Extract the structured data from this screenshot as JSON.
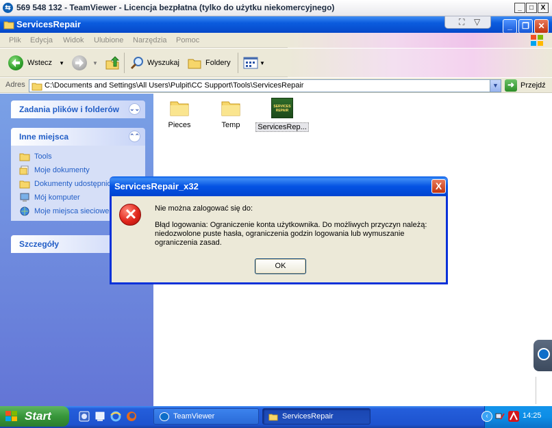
{
  "teamviewer": {
    "title": "569 548 132 - TeamViewer - Licencja bezpłatna (tylko do użytku niekomercyjnego)",
    "minimize": "_",
    "maximize": "□",
    "close": "X"
  },
  "explorer": {
    "title": "ServicesRepair",
    "menu": [
      "Plik",
      "Edycja",
      "Widok",
      "Ulubione",
      "Narzędzia",
      "Pomoc"
    ],
    "toolbar": {
      "back_label": "Wstecz",
      "search_label": "Wyszukaj",
      "folders_label": "Foldery"
    },
    "address": {
      "label": "Adres",
      "path": "C:\\Documents and Settings\\All Users\\Pulpit\\CC Support\\Tools\\ServicesRepair",
      "go_label": "Przejdź"
    },
    "left_panel": {
      "tasks_title": "Zadania plików i folderów",
      "places_title": "Inne miejsca",
      "places": [
        "Tools",
        "Moje dokumenty",
        "Dokumenty udostępnione",
        "Mój komputer",
        "Moje miejsca sieciowe"
      ],
      "details_title": "Szczegóły"
    },
    "files": [
      {
        "name": "Pieces",
        "type": "folder"
      },
      {
        "name": "Temp",
        "type": "folder"
      },
      {
        "name": "ServicesRep...",
        "type": "app",
        "icon_text": "SERVICES REPAIR"
      }
    ]
  },
  "dialog": {
    "title": "ServicesRepair_x32",
    "line1": "Nie można zalogować się do:",
    "line2": "Błąd logowania: Ograniczenie konta użytkownika. Do możliwych przyczyn należą: niedozwolone puste hasła, ograniczenia godzin logowania lub wymuszanie ograniczenia zasad.",
    "ok_label": "OK",
    "close_glyph": "X"
  },
  "taskbar": {
    "start_label": "Start",
    "tasks": [
      "TeamViewer",
      "ServicesRepair"
    ],
    "clock": "14:25"
  },
  "colors": {
    "xp_blue": "#0b5cde",
    "panel_blue": "#6375d6",
    "start_green": "#37963a",
    "error_red": "#e1261c"
  }
}
